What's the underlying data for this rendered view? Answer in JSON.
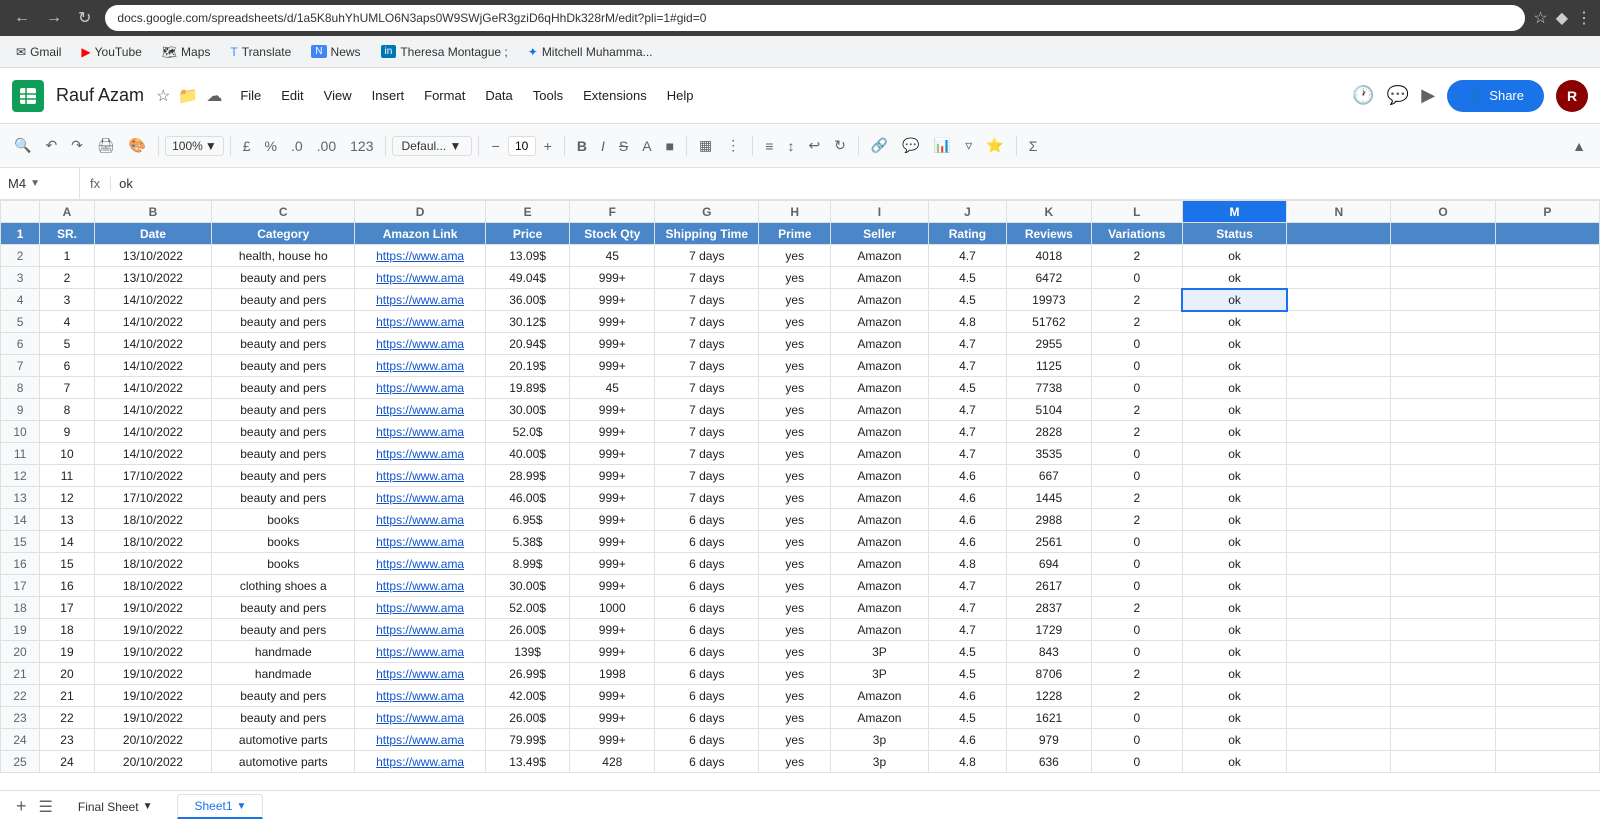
{
  "chrome": {
    "url": "docs.google.com/spreadsheets/d/1a5K8uhYhUMLO6N3aps0W9SWjGeR3gziD6qHhDk328rM/edit?pli=1#gid=0",
    "back_btn": "←",
    "forward_btn": "→",
    "reload_btn": "↺"
  },
  "bookmarks": [
    {
      "label": "Gmail",
      "icon": "✉"
    },
    {
      "label": "YouTube",
      "icon": "▶"
    },
    {
      "label": "Maps",
      "icon": "🗺"
    },
    {
      "label": "Translate",
      "icon": "T"
    },
    {
      "label": "News",
      "icon": "N"
    },
    {
      "label": "Theresa Montague ;",
      "icon": "in"
    },
    {
      "label": "Mitchell Muhamma...",
      "icon": "✦"
    }
  ],
  "header": {
    "title": "Rauf Azam",
    "logo_letter": "≡",
    "menu_items": [
      "File",
      "Edit",
      "View",
      "Insert",
      "Format",
      "Data",
      "Tools",
      "Extensions",
      "Help"
    ],
    "share_label": "Share"
  },
  "toolbar": {
    "zoom": "100%",
    "currency": "£",
    "percent": "%",
    "decimal_decrease": ".0",
    "decimal_increase": ".00",
    "format_number": "123",
    "font": "Defaul...",
    "font_size": "10",
    "bold": "B",
    "italic": "I",
    "strikethrough": "S"
  },
  "formula_bar": {
    "cell_ref": "M4",
    "fx": "fx",
    "formula": "ok"
  },
  "columns": {
    "headers": [
      "",
      "A",
      "B",
      "C",
      "D",
      "E",
      "F",
      "G",
      "H",
      "I",
      "J",
      "K",
      "L",
      "M",
      "N",
      "O",
      "P"
    ],
    "col_labels": [
      "SR.",
      "Date",
      "Category",
      "Amazon Link",
      "Price",
      "Stock Qty",
      "Shipping Time",
      "Prime",
      "Seller",
      "Rating",
      "Reviews",
      "Variations",
      "Status"
    ]
  },
  "rows": [
    {
      "num": 2,
      "sr": "1",
      "date": "13/10/2022",
      "category": "health, house ho",
      "link": "https://www.ama",
      "price": "13.09$",
      "stock": "45",
      "shipping": "7 days",
      "prime": "yes",
      "seller": "Amazon",
      "rating": "4.7",
      "reviews": "4018",
      "variations": "2",
      "status": "ok"
    },
    {
      "num": 3,
      "sr": "2",
      "date": "13/10/2022",
      "category": "beauty and pers",
      "link": "https://www.ama",
      "price": "49.04$",
      "stock": "999+",
      "shipping": "7 days",
      "prime": "yes",
      "seller": "Amazon",
      "rating": "4.5",
      "reviews": "6472",
      "variations": "0",
      "status": "ok"
    },
    {
      "num": 4,
      "sr": "3",
      "date": "14/10/2022",
      "category": "beauty and pers",
      "link": "https://www.ama",
      "price": "36.00$",
      "stock": "999+",
      "shipping": "7 days",
      "prime": "yes",
      "seller": "Amazon",
      "rating": "4.5",
      "reviews": "19973",
      "variations": "2",
      "status": "ok",
      "selected": true
    },
    {
      "num": 5,
      "sr": "4",
      "date": "14/10/2022",
      "category": "beauty and pers",
      "link": "https://www.ama",
      "price": "30.12$",
      "stock": "999+",
      "shipping": "7 days",
      "prime": "yes",
      "seller": "Amazon",
      "rating": "4.8",
      "reviews": "51762",
      "variations": "2",
      "status": "ok"
    },
    {
      "num": 6,
      "sr": "5",
      "date": "14/10/2022",
      "category": "beauty and pers",
      "link": "https://www.ama",
      "price": "20.94$",
      "stock": "999+",
      "shipping": "7 days",
      "prime": "yes",
      "seller": "Amazon",
      "rating": "4.7",
      "reviews": "2955",
      "variations": "0",
      "status": "ok"
    },
    {
      "num": 7,
      "sr": "6",
      "date": "14/10/2022",
      "category": "beauty and pers",
      "link": "https://www.ama",
      "price": "20.19$",
      "stock": "999+",
      "shipping": "7 days",
      "prime": "yes",
      "seller": "Amazon",
      "rating": "4.7",
      "reviews": "1125",
      "variations": "0",
      "status": "ok"
    },
    {
      "num": 8,
      "sr": "7",
      "date": "14/10/2022",
      "category": "beauty and pers",
      "link": "https://www.ama",
      "price": "19.89$",
      "stock": "45",
      "shipping": "7 days",
      "prime": "yes",
      "seller": "Amazon",
      "rating": "4.5",
      "reviews": "7738",
      "variations": "0",
      "status": "ok"
    },
    {
      "num": 9,
      "sr": "8",
      "date": "14/10/2022",
      "category": "beauty and pers",
      "link": "https://www.ama",
      "price": "30.00$",
      "stock": "999+",
      "shipping": "7 days",
      "prime": "yes",
      "seller": "Amazon",
      "rating": "4.7",
      "reviews": "5104",
      "variations": "2",
      "status": "ok"
    },
    {
      "num": 10,
      "sr": "9",
      "date": "14/10/2022",
      "category": "beauty and pers",
      "link": "https://www.ama",
      "price": "52.0$",
      "stock": "999+",
      "shipping": "7 days",
      "prime": "yes",
      "seller": "Amazon",
      "rating": "4.7",
      "reviews": "2828",
      "variations": "2",
      "status": "ok"
    },
    {
      "num": 11,
      "sr": "10",
      "date": "14/10/2022",
      "category": "beauty and pers",
      "link": "https://www.ama",
      "price": "40.00$",
      "stock": "999+",
      "shipping": "7 days",
      "prime": "yes",
      "seller": "Amazon",
      "rating": "4.7",
      "reviews": "3535",
      "variations": "0",
      "status": "ok"
    },
    {
      "num": 12,
      "sr": "11",
      "date": "17/10/2022",
      "category": "beauty and pers",
      "link": "https://www.ama",
      "price": "28.99$",
      "stock": "999+",
      "shipping": "7 days",
      "prime": "yes",
      "seller": "Amazon",
      "rating": "4.6",
      "reviews": "667",
      "variations": "0",
      "status": "ok"
    },
    {
      "num": 13,
      "sr": "12",
      "date": "17/10/2022",
      "category": "beauty and pers",
      "link": "https://www.ama",
      "price": "46.00$",
      "stock": "999+",
      "shipping": "7 days",
      "prime": "yes",
      "seller": "Amazon",
      "rating": "4.6",
      "reviews": "1445",
      "variations": "2",
      "status": "ok"
    },
    {
      "num": 14,
      "sr": "13",
      "date": "18/10/2022",
      "category": "books",
      "link": "https://www.ama",
      "price": "6.95$",
      "stock": "999+",
      "shipping": "6 days",
      "prime": "yes",
      "seller": "Amazon",
      "rating": "4.6",
      "reviews": "2988",
      "variations": "2",
      "status": "ok"
    },
    {
      "num": 15,
      "sr": "14",
      "date": "18/10/2022",
      "category": "books",
      "link": "https://www.ama",
      "price": "5.38$",
      "stock": "999+",
      "shipping": "6 days",
      "prime": "yes",
      "seller": "Amazon",
      "rating": "4.6",
      "reviews": "2561",
      "variations": "0",
      "status": "ok"
    },
    {
      "num": 16,
      "sr": "15",
      "date": "18/10/2022",
      "category": "books",
      "link": "https://www.ama",
      "price": "8.99$",
      "stock": "999+",
      "shipping": "6 days",
      "prime": "yes",
      "seller": "Amazon",
      "rating": "4.8",
      "reviews": "694",
      "variations": "0",
      "status": "ok"
    },
    {
      "num": 17,
      "sr": "16",
      "date": "18/10/2022",
      "category": "clothing shoes a",
      "link": "https://www.ama",
      "price": "30.00$",
      "stock": "999+",
      "shipping": "6 days",
      "prime": "yes",
      "seller": "Amazon",
      "rating": "4.7",
      "reviews": "2617",
      "variations": "0",
      "status": "ok"
    },
    {
      "num": 18,
      "sr": "17",
      "date": "19/10/2022",
      "category": "beauty and pers",
      "link": "https://www.ama",
      "price": "52.00$",
      "stock": "1000",
      "shipping": "6 days",
      "prime": "yes",
      "seller": "Amazon",
      "rating": "4.7",
      "reviews": "2837",
      "variations": "2",
      "status": "ok"
    },
    {
      "num": 19,
      "sr": "18",
      "date": "19/10/2022",
      "category": "beauty and pers",
      "link": "https://www.ama",
      "price": "26.00$",
      "stock": "999+",
      "shipping": "6 days",
      "prime": "yes",
      "seller": "Amazon",
      "rating": "4.7",
      "reviews": "1729",
      "variations": "0",
      "status": "ok"
    },
    {
      "num": 20,
      "sr": "19",
      "date": "19/10/2022",
      "category": "handmade",
      "link": "https://www.ama",
      "price": "139$",
      "stock": "999+",
      "shipping": "6 days",
      "prime": "yes",
      "seller": "3P",
      "rating": "4.5",
      "reviews": "843",
      "variations": "0",
      "status": "ok"
    },
    {
      "num": 21,
      "sr": "20",
      "date": "19/10/2022",
      "category": "handmade",
      "link": "https://www.ama",
      "price": "26.99$",
      "stock": "1998",
      "shipping": "6 days",
      "prime": "yes",
      "seller": "3P",
      "rating": "4.5",
      "reviews": "8706",
      "variations": "2",
      "status": "ok"
    },
    {
      "num": 22,
      "sr": "21",
      "date": "19/10/2022",
      "category": "beauty and pers",
      "link": "https://www.ama",
      "price": "42.00$",
      "stock": "999+",
      "shipping": "6 days",
      "prime": "yes",
      "seller": "Amazon",
      "rating": "4.6",
      "reviews": "1228",
      "variations": "2",
      "status": "ok"
    },
    {
      "num": 23,
      "sr": "22",
      "date": "19/10/2022",
      "category": "beauty and pers",
      "link": "https://www.ama",
      "price": "26.00$",
      "stock": "999+",
      "shipping": "6 days",
      "prime": "yes",
      "seller": "Amazon",
      "rating": "4.5",
      "reviews": "1621",
      "variations": "0",
      "status": "ok"
    },
    {
      "num": 24,
      "sr": "23",
      "date": "20/10/2022",
      "category": "automotive parts",
      "link": "https://www.ama",
      "price": "79.99$",
      "stock": "999+",
      "shipping": "6 days",
      "prime": "yes",
      "seller": "3p",
      "rating": "4.6",
      "reviews": "979",
      "variations": "0",
      "status": "ok"
    },
    {
      "num": 25,
      "sr": "24",
      "date": "20/10/2022",
      "category": "automotive parts",
      "link": "https://www.ama",
      "price": "13.49$",
      "stock": "428",
      "shipping": "6 days",
      "prime": "yes",
      "seller": "3p",
      "rating": "4.8",
      "reviews": "636",
      "variations": "0",
      "status": "ok"
    }
  ],
  "sheets": {
    "tabs": [
      "Final Sheet",
      "Sheet1"
    ],
    "active_tab": "Sheet1"
  }
}
